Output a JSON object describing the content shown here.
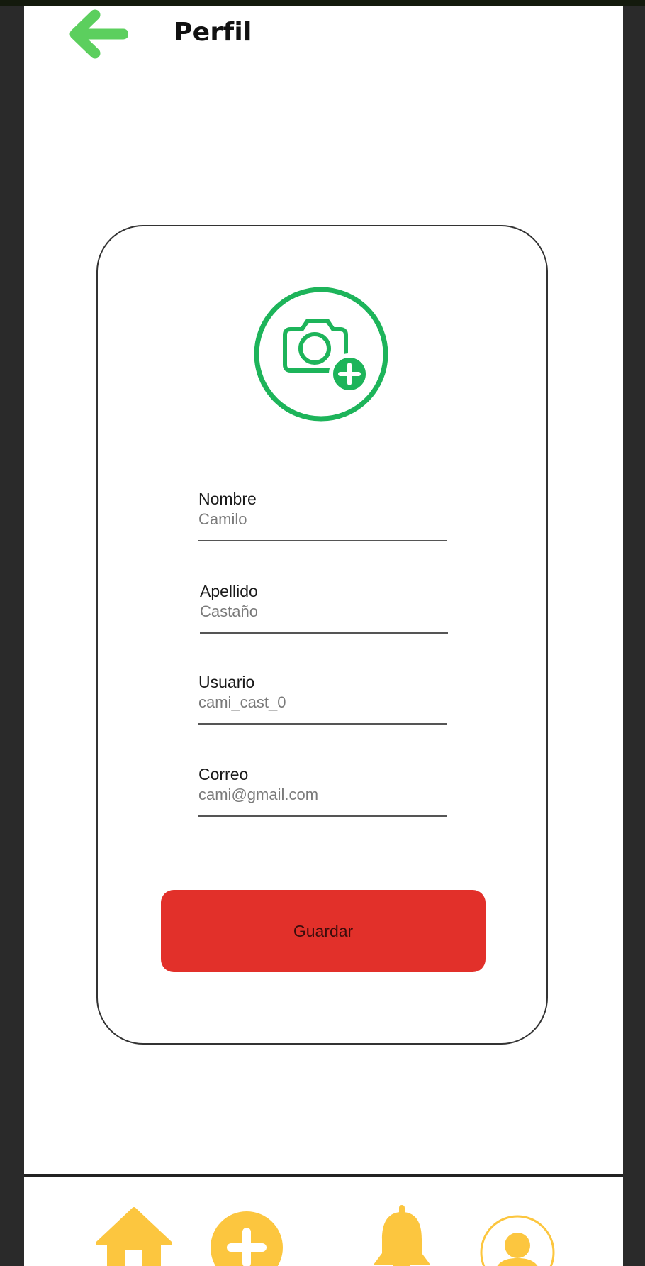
{
  "header": {
    "title": "Perfil",
    "back_icon": "arrow-left-icon"
  },
  "profile_photo": {
    "icon": "camera-add-icon"
  },
  "form": {
    "fields": [
      {
        "label": "Nombre",
        "value": "Camilo"
      },
      {
        "label": "Apellido",
        "value": "Castaño"
      },
      {
        "label": "Usuario",
        "value": "cami_cast_0"
      },
      {
        "label": "Correo",
        "value": "cami@gmail.com"
      }
    ],
    "save_label": "Guardar"
  },
  "bottom_nav": {
    "items": [
      {
        "icon": "home-icon"
      },
      {
        "icon": "add-circle-icon"
      },
      {
        "icon": "bell-icon"
      },
      {
        "icon": "user-profile-icon"
      }
    ]
  },
  "colors": {
    "accent_green": "#1db45a",
    "back_arrow_green": "#5ccf5e",
    "save_red": "#e2302a",
    "nav_yellow": "#fcc63f",
    "frame": "#2a2a2a"
  }
}
